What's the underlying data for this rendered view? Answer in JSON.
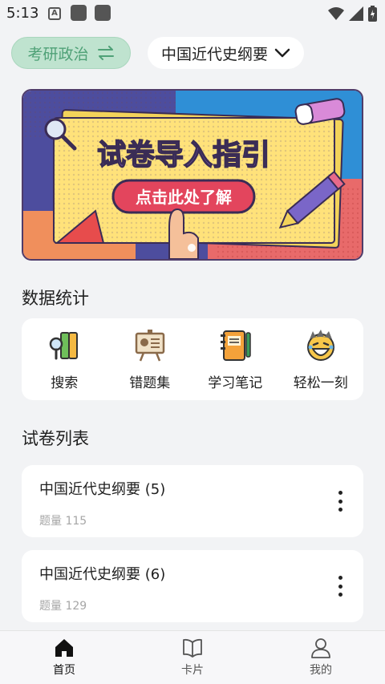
{
  "status_bar": {
    "time": "5:13",
    "notif_letter": "A"
  },
  "header": {
    "subject": "考研政治",
    "course": "中国近代史纲要"
  },
  "banner": {
    "title": "试卷导入指引",
    "button": "点击此处了解"
  },
  "stats": {
    "title": "数据统计",
    "items": [
      {
        "label": "搜索",
        "icon": "search-binders-icon"
      },
      {
        "label": "错题集",
        "icon": "presentation-board-icon"
      },
      {
        "label": "学习笔记",
        "icon": "notebook-icon"
      },
      {
        "label": "轻松一刻",
        "icon": "laughing-face-icon"
      }
    ]
  },
  "papers": {
    "title": "试卷列表",
    "items": [
      {
        "name": "中国近代史纲要 (5)",
        "count": "题量 115"
      },
      {
        "name": "中国近代史纲要 (6)",
        "count": "题量 129"
      }
    ]
  },
  "nav": {
    "items": [
      {
        "label": "首页",
        "icon": "home-icon",
        "active": true
      },
      {
        "label": "卡片",
        "icon": "book-icon",
        "active": false
      },
      {
        "label": "我的",
        "icon": "person-icon",
        "active": false
      }
    ]
  },
  "colors": {
    "accent_green": "#4fa177",
    "pill_green_bg": "#bfe3cf"
  }
}
